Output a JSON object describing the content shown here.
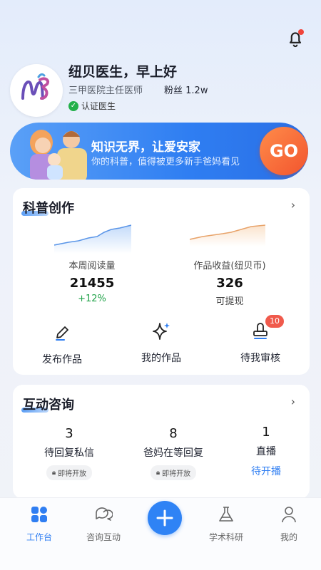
{
  "header": {
    "greeting": "纽贝医生，早上好",
    "title": "三甲医院主任医师",
    "fans_label": "粉丝",
    "fans_count": "1.2w",
    "certified": "认证医生"
  },
  "banner": {
    "title": "知识无界，让爱安家",
    "subtitle": "你的科普，值得被更多新手爸妈看见",
    "go_label": "GO"
  },
  "science": {
    "title": "科普创作",
    "reads": {
      "label": "本周阅读量",
      "value": "21455",
      "change": "+12%"
    },
    "income": {
      "label": "作品收益(纽贝币)",
      "value": "326",
      "sub": "可提现"
    },
    "actions": [
      {
        "label": "发布作品",
        "icon": "pencil-icon"
      },
      {
        "label": "我的作品",
        "icon": "sparkle-icon"
      },
      {
        "label": "待我审核",
        "icon": "stamp-icon",
        "badge": "10"
      }
    ]
  },
  "consult": {
    "title": "互动咨询",
    "items": [
      {
        "count": "3",
        "label": "待回复私信",
        "pill": "即将开放"
      },
      {
        "count": "8",
        "label": "爸妈在等回复",
        "pill": "即将开放"
      },
      {
        "count": "1",
        "label": "直播",
        "link": "待开播"
      }
    ]
  },
  "tabs": [
    {
      "label": "工作台",
      "icon": "grid-icon",
      "active": true
    },
    {
      "label": "咨询互动",
      "icon": "chat-icon"
    },
    {
      "label": "学术科研",
      "icon": "flask-icon"
    },
    {
      "label": "我的",
      "icon": "person-icon"
    }
  ],
  "colors": {
    "accent": "#2f7ef2",
    "go": "#f2542e",
    "positive": "#22a34a",
    "badge": "#f05a4c"
  }
}
